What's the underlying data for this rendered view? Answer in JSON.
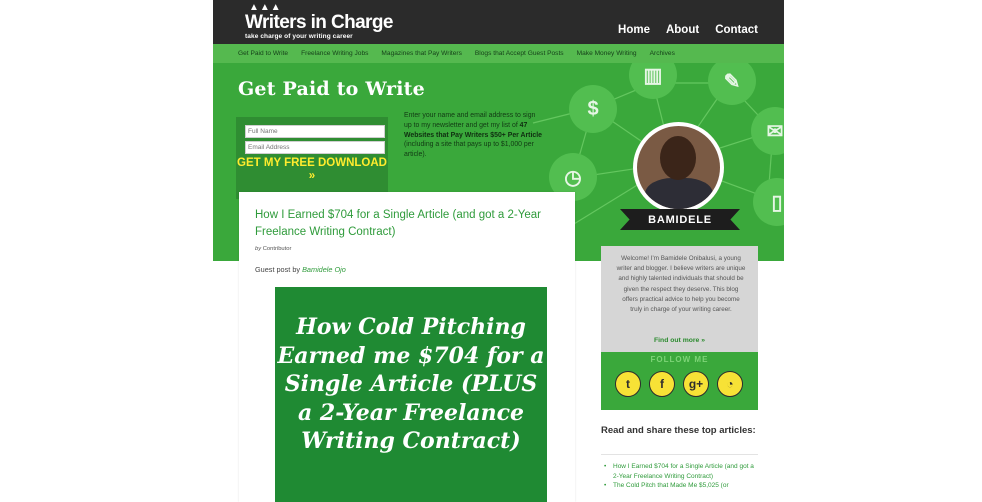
{
  "site": {
    "logo_name": "Writers in Charge",
    "logo_tagline": "take charge of your writing career"
  },
  "top_nav": [
    "Home",
    "About",
    "Contact"
  ],
  "sub_nav": [
    "Get Paid to Write",
    "Freelance Writing Jobs",
    "Magazines that Pay Writers",
    "Blogs that Accept Guest Posts",
    "Make Money Writing",
    "Archives"
  ],
  "hero": {
    "title": "Get Paid to Write",
    "name_placeholder": "Full Name",
    "email_placeholder": "Email Address",
    "cta": "GET MY FREE DOWNLOAD »",
    "pitch_start": "Enter your name and email address to sign up to my newsletter and get my list of ",
    "pitch_bold": "47 Websites that Pay Writers $50+ Per Article",
    "pitch_end": " (including a site that pays up to $1,000 per article)."
  },
  "author": {
    "name": "BAMIDELE"
  },
  "post": {
    "title": "How I Earned $704 for a Single Article (and got a 2-Year Freelance Writing Contract)",
    "byline_prefix": "by",
    "byline_name": "Contributor",
    "guest_prefix": "Guest post by ",
    "guest_name": "Bamidele Ojo",
    "feature_text": "How Cold Pitching Earned me $704 for a Single Article (PLUS a 2-Year Freelance Writing Contract)"
  },
  "sidebar": {
    "bio": "Welcome! I'm Bamidele Onibalusi, a young writer and blogger. I believe writers are unique and highly talented individuals that should be given the respect they deserve. This blog offers practical advice to help you become truly in charge of your writing career.",
    "find_out": "Find out more »",
    "follow_label": "FOLLOW ME",
    "social_icons": [
      "twitter-icon",
      "facebook-icon",
      "google-plus-icon",
      "rss-icon"
    ],
    "read_heading": "Read and share these top articles:",
    "articles": [
      "How I Earned $704 for a Single Article (and got a 2-Year Freelance Writing Contract)",
      "The Cold Pitch that Made Me $5,025 (or"
    ]
  }
}
